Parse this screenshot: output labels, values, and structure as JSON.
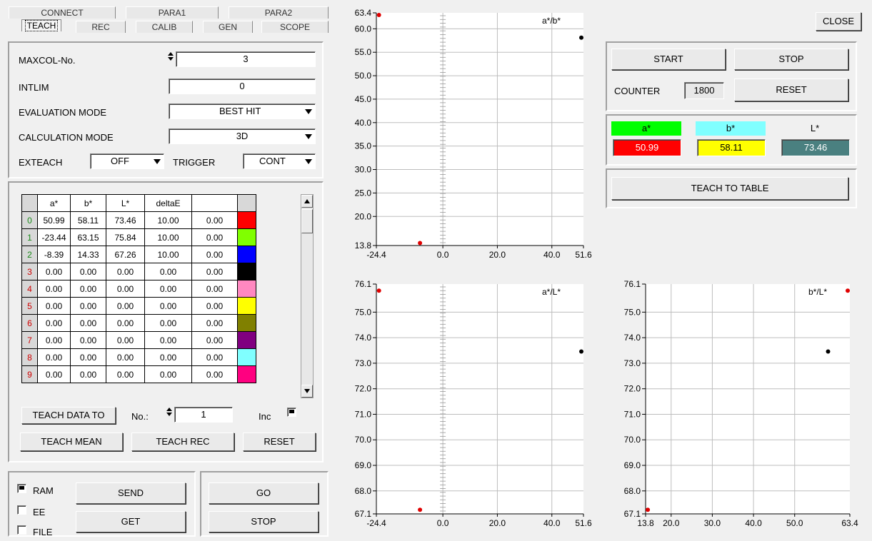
{
  "tabs_row1": [
    "CONNECT",
    "PARA1",
    "PARA2"
  ],
  "tabs_row2": [
    "TEACH",
    "REC",
    "CALIB",
    "GEN",
    "SCOPE"
  ],
  "teach": {
    "maxcol_label": "MAXCOL-No.",
    "maxcol_value": "3",
    "intlim_label": "INTLIM",
    "intlim_value": "0",
    "eval_label": "EVALUATION MODE",
    "eval_value": "BEST HIT",
    "calc_label": "CALCULATION MODE",
    "calc_value": "3D",
    "exteach_label": "EXTEACH",
    "exteach_value": "OFF",
    "trigger_label": "TRIGGER",
    "trigger_value": "CONT"
  },
  "table": {
    "headers": [
      "a*",
      "b*",
      "L*",
      "deltaE",
      ""
    ],
    "rows": [
      {
        "n": "0",
        "a": "50.99",
        "b": "58.11",
        "l": "73.46",
        "de": "10.00",
        "v": "0.00",
        "color": "#ff0000"
      },
      {
        "n": "1",
        "a": "-23.44",
        "b": "63.15",
        "l": "75.84",
        "de": "10.00",
        "v": "0.00",
        "color": "#80ff00"
      },
      {
        "n": "2",
        "a": "-8.39",
        "b": "14.33",
        "l": "67.26",
        "de": "10.00",
        "v": "0.00",
        "color": "#0000ff"
      },
      {
        "n": "3",
        "a": "0.00",
        "b": "0.00",
        "l": "0.00",
        "de": "0.00",
        "v": "0.00",
        "color": "#000000"
      },
      {
        "n": "4",
        "a": "0.00",
        "b": "0.00",
        "l": "0.00",
        "de": "0.00",
        "v": "0.00",
        "color": "#ff88c0"
      },
      {
        "n": "5",
        "a": "0.00",
        "b": "0.00",
        "l": "0.00",
        "de": "0.00",
        "v": "0.00",
        "color": "#ffff00"
      },
      {
        "n": "6",
        "a": "0.00",
        "b": "0.00",
        "l": "0.00",
        "de": "0.00",
        "v": "0.00",
        "color": "#808000"
      },
      {
        "n": "7",
        "a": "0.00",
        "b": "0.00",
        "l": "0.00",
        "de": "0.00",
        "v": "0.00",
        "color": "#800080"
      },
      {
        "n": "8",
        "a": "0.00",
        "b": "0.00",
        "l": "0.00",
        "de": "0.00",
        "v": "0.00",
        "color": "#80ffff"
      },
      {
        "n": "9",
        "a": "0.00",
        "b": "0.00",
        "l": "0.00",
        "de": "0.00",
        "v": "0.00",
        "color": "#ff0080"
      }
    ]
  },
  "teach_actions": {
    "teach_data_to": "TEACH DATA TO",
    "no_label": "No.:",
    "no_value": "1",
    "inc_label": "Inc",
    "teach_mean": "TEACH MEAN",
    "teach_rec": "TEACH REC",
    "reset": "RESET"
  },
  "bottom": {
    "ram": "RAM",
    "ee": "EE",
    "file": "FILE",
    "send": "SEND",
    "get": "GET",
    "go": "GO",
    "stop": "STOP"
  },
  "right": {
    "close": "CLOSE",
    "start": "START",
    "stop": "STOP",
    "counter_label": "COUNTER",
    "counter_value": "1800",
    "reset": "RESET",
    "a_label": "a*",
    "b_label": "b*",
    "l_label": "L*",
    "a_value": "50.99",
    "b_value": "58.11",
    "l_value": "73.46",
    "teach_to_table": "TEACH TO TABLE",
    "colors": {
      "a_head": "#00ff00",
      "b_head": "#80ffff",
      "a_val": "#ff0000",
      "b_val": "#ffff00",
      "l_val": "#4a8080"
    }
  },
  "chart_data": [
    {
      "type": "scatter",
      "title": "a*/b*",
      "xlim": [
        -24.4,
        51.6
      ],
      "ylim": [
        13.8,
        63.4
      ],
      "xticks": [
        "-24.4",
        "0.0",
        "20.0",
        "40.0",
        "51.6"
      ],
      "yticks": [
        "13.8",
        "20.0",
        "25.0",
        "30.0",
        "35.0",
        "40.0",
        "45.0",
        "50.0",
        "55.0",
        "60.0",
        "63.4"
      ],
      "points": [
        {
          "x": -23.44,
          "y": 63.15,
          "c": "red"
        },
        {
          "x": -8.39,
          "y": 14.33,
          "c": "red"
        },
        {
          "x": 50.99,
          "y": 58.11,
          "c": "black"
        }
      ]
    },
    {
      "type": "scatter",
      "title": "a*/L*",
      "xlim": [
        -24.4,
        51.6
      ],
      "ylim": [
        67.1,
        76.1
      ],
      "xticks": [
        "-24.4",
        "0.0",
        "20.0",
        "40.0",
        "51.6"
      ],
      "yticks": [
        "67.1",
        "68.0",
        "69.0",
        "70.0",
        "71.0",
        "72.0",
        "73.0",
        "74.0",
        "75.0",
        "76.1"
      ],
      "points": [
        {
          "x": -23.44,
          "y": 75.84,
          "c": "red"
        },
        {
          "x": -8.39,
          "y": 67.26,
          "c": "red"
        },
        {
          "x": 50.99,
          "y": 73.46,
          "c": "black"
        }
      ]
    },
    {
      "type": "scatter",
      "title": "b*/L*",
      "xlim": [
        13.8,
        63.4
      ],
      "ylim": [
        67.1,
        76.1
      ],
      "xticks": [
        "13.8",
        "20.0",
        "30.0",
        "40.0",
        "50.0",
        "63.4"
      ],
      "yticks": [
        "67.1",
        "68.0",
        "69.0",
        "70.0",
        "71.0",
        "72.0",
        "73.0",
        "74.0",
        "75.0",
        "76.1"
      ],
      "points": [
        {
          "x": 63.15,
          "y": 75.84,
          "c": "red"
        },
        {
          "x": 14.33,
          "y": 67.26,
          "c": "red"
        },
        {
          "x": 58.11,
          "y": 73.46,
          "c": "black"
        }
      ]
    }
  ]
}
